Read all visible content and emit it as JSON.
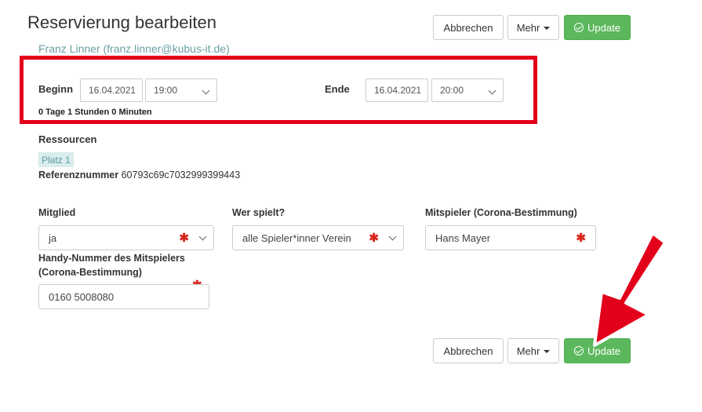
{
  "header": {
    "title": "Reservierung bearbeiten",
    "user": "Franz Linner (franz.linner@kubus-it.de)"
  },
  "toolbar": {
    "cancel_label": "Abbrechen",
    "more_label": "Mehr",
    "update_label": "Update"
  },
  "time": {
    "begin_label": "Beginn",
    "begin_date": "16.04.2021",
    "begin_time": "19:00",
    "end_label": "Ende",
    "end_date": "16.04.2021",
    "end_time": "20:00",
    "duration": "0 Tage 1 Stunden 0 Minuten"
  },
  "resources": {
    "label": "Ressourcen",
    "items": [
      "Platz 1"
    ],
    "ref_label": "Referenznummer",
    "ref_value": "60793c69c7032999399443"
  },
  "form": {
    "member_label": "Mitglied",
    "member_value": "ja",
    "who_label": "Wer spielt?",
    "who_value": "alle Spieler*inner Verein",
    "partner_label": "Mitspieler (Corona-Bestimmung)",
    "partner_value": "Hans Mayer",
    "phone_label": "Handy-Nummer des Mitspielers (Corona-Bestimmung)",
    "phone_value": "0160 5008080",
    "required_mark": "✱"
  },
  "colors": {
    "success": "#5cb85c",
    "highlight": "#e2001a",
    "link": "#6a9fa3",
    "tag_bg": "#d9ecee"
  },
  "icons": {
    "update": "check-circle-icon",
    "more": "caret-down-icon",
    "select": "chevron-down-icon",
    "required": "asterisk-icon",
    "annotation": "red-arrow"
  }
}
